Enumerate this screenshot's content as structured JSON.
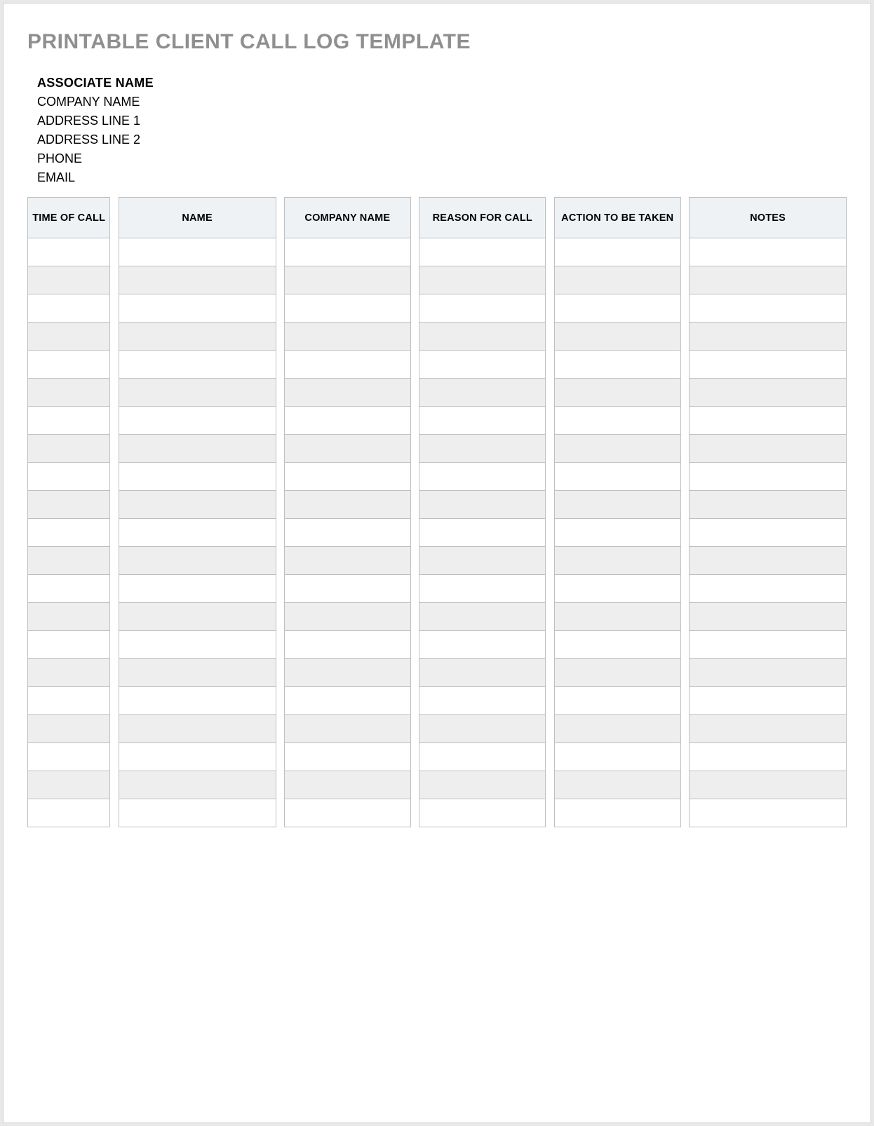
{
  "title": "PRINTABLE CLIENT CALL LOG TEMPLATE",
  "info": {
    "associate": "ASSOCIATE NAME",
    "company": "COMPANY NAME",
    "address1": "ADDRESS LINE 1",
    "address2": "ADDRESS LINE 2",
    "phone": "PHONE",
    "email": "EMAIL"
  },
  "columns": {
    "time": "TIME OF CALL",
    "name": "NAME",
    "company": "COMPANY NAME",
    "reason": "REASON FOR CALL",
    "action": "ACTION TO BE TAKEN",
    "notes": "NOTES"
  },
  "row_count": 21,
  "rows": [
    {
      "time": "",
      "name": "",
      "company": "",
      "reason": "",
      "action": "",
      "notes": ""
    },
    {
      "time": "",
      "name": "",
      "company": "",
      "reason": "",
      "action": "",
      "notes": ""
    },
    {
      "time": "",
      "name": "",
      "company": "",
      "reason": "",
      "action": "",
      "notes": ""
    },
    {
      "time": "",
      "name": "",
      "company": "",
      "reason": "",
      "action": "",
      "notes": ""
    },
    {
      "time": "",
      "name": "",
      "company": "",
      "reason": "",
      "action": "",
      "notes": ""
    },
    {
      "time": "",
      "name": "",
      "company": "",
      "reason": "",
      "action": "",
      "notes": ""
    },
    {
      "time": "",
      "name": "",
      "company": "",
      "reason": "",
      "action": "",
      "notes": ""
    },
    {
      "time": "",
      "name": "",
      "company": "",
      "reason": "",
      "action": "",
      "notes": ""
    },
    {
      "time": "",
      "name": "",
      "company": "",
      "reason": "",
      "action": "",
      "notes": ""
    },
    {
      "time": "",
      "name": "",
      "company": "",
      "reason": "",
      "action": "",
      "notes": ""
    },
    {
      "time": "",
      "name": "",
      "company": "",
      "reason": "",
      "action": "",
      "notes": ""
    },
    {
      "time": "",
      "name": "",
      "company": "",
      "reason": "",
      "action": "",
      "notes": ""
    },
    {
      "time": "",
      "name": "",
      "company": "",
      "reason": "",
      "action": "",
      "notes": ""
    },
    {
      "time": "",
      "name": "",
      "company": "",
      "reason": "",
      "action": "",
      "notes": ""
    },
    {
      "time": "",
      "name": "",
      "company": "",
      "reason": "",
      "action": "",
      "notes": ""
    },
    {
      "time": "",
      "name": "",
      "company": "",
      "reason": "",
      "action": "",
      "notes": ""
    },
    {
      "time": "",
      "name": "",
      "company": "",
      "reason": "",
      "action": "",
      "notes": ""
    },
    {
      "time": "",
      "name": "",
      "company": "",
      "reason": "",
      "action": "",
      "notes": ""
    },
    {
      "time": "",
      "name": "",
      "company": "",
      "reason": "",
      "action": "",
      "notes": ""
    },
    {
      "time": "",
      "name": "",
      "company": "",
      "reason": "",
      "action": "",
      "notes": ""
    },
    {
      "time": "",
      "name": "",
      "company": "",
      "reason": "",
      "action": "",
      "notes": ""
    }
  ]
}
